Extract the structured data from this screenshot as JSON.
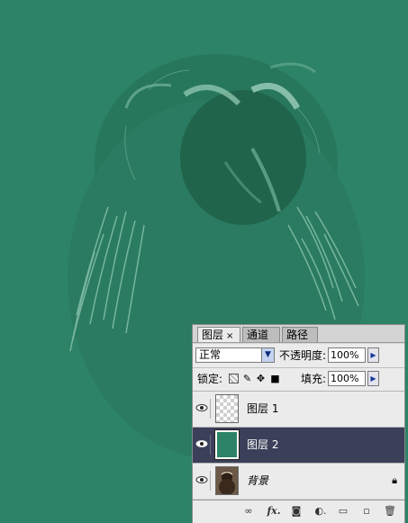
{
  "tabs": [
    {
      "label": "图层",
      "close": "×",
      "active": true
    },
    {
      "label": "通道",
      "active": false
    },
    {
      "label": "路径",
      "active": false
    }
  ],
  "blend_mode": "正常",
  "opacity_label": "不透明度:",
  "opacity_value": "100%",
  "lock_label": "锁定:",
  "fill_label": "填充:",
  "fill_value": "100%",
  "layers": [
    {
      "name": "图层 1",
      "thumbnail": "transparent",
      "visible": true,
      "selected": false
    },
    {
      "name": "图层 2",
      "thumbnail": "green-fill",
      "visible": true,
      "selected": true
    },
    {
      "name": "背景",
      "thumbnail": "photo",
      "visible": true,
      "selected": false,
      "locked": true
    }
  ],
  "footer_icons": [
    "link-icon",
    "fx-icon",
    "mask-icon",
    "adjustment-icon",
    "group-icon",
    "new-layer-icon",
    "trash-icon"
  ],
  "colors": {
    "canvas_bg": "#2d8367",
    "selected_layer": "#3b3f59",
    "panel_bg": "#ebebeb"
  }
}
